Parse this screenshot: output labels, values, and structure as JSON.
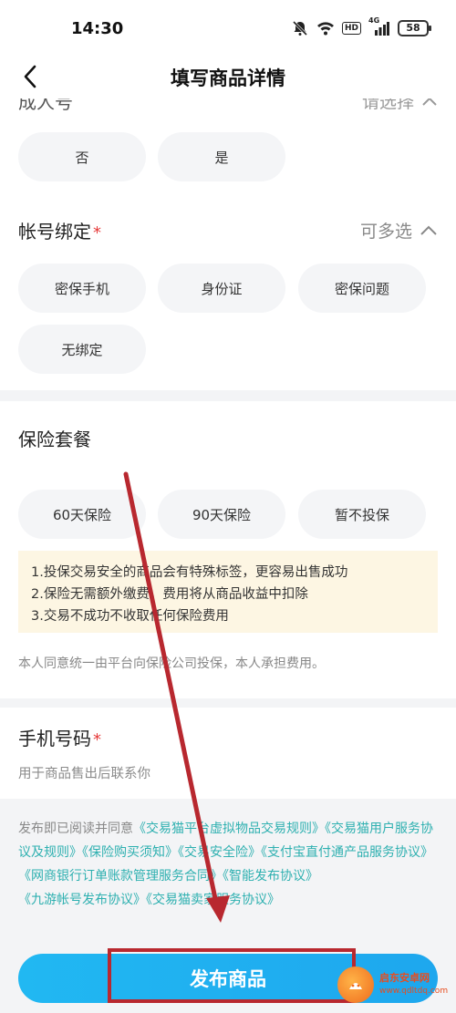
{
  "status": {
    "time": "14:30",
    "hd": "HD",
    "signal": "4G",
    "battery": "58"
  },
  "nav": {
    "title": "填写商品详情"
  },
  "adult": {
    "title": "成人号",
    "hint": "请选择",
    "options": [
      "否",
      "是"
    ]
  },
  "binding": {
    "title": "帐号绑定",
    "required": "*",
    "hint": "可多选",
    "options": [
      "密保手机",
      "身份证",
      "密保问题",
      "无绑定"
    ]
  },
  "insurance": {
    "title": "保险套餐",
    "options": [
      "60天保险",
      "90天保险",
      "暂不投保"
    ],
    "notices": [
      "1.投保交易安全的商品会有特殊标签，更容易出售成功",
      "2.保险无需额外缴费，费用将从商品收益中扣除",
      "3.交易不成功不收取任何保险费用"
    ],
    "consent": "本人同意统一由平台向保险公司投保，本人承担费用。"
  },
  "phone": {
    "title": "手机号码",
    "required": "*",
    "subtitle": "用于商品售出后联系你"
  },
  "agreement": {
    "prefix": "发布即已阅读并同意",
    "links": [
      "《交易猫平台虚拟物品交易规则》",
      "《交易猫用户服务协议及规则》",
      "《保险购买须知》",
      "《交易安全险》",
      "《支付宝直付通产品服务协议》",
      "《网商银行订单账款管理服务合同》",
      "《智能发布协议》",
      "《九游帐号发布协议》",
      "《交易猫卖家服务协议》"
    ]
  },
  "publish": {
    "label": "发布商品"
  },
  "watermark": {
    "name": "启东安卓网",
    "url": "www.qdltdq.com"
  },
  "colors": {
    "accent": "#1ea7ee",
    "link": "#2eb0b0",
    "annotation": "#b8282f",
    "required": "#e63b3b"
  }
}
